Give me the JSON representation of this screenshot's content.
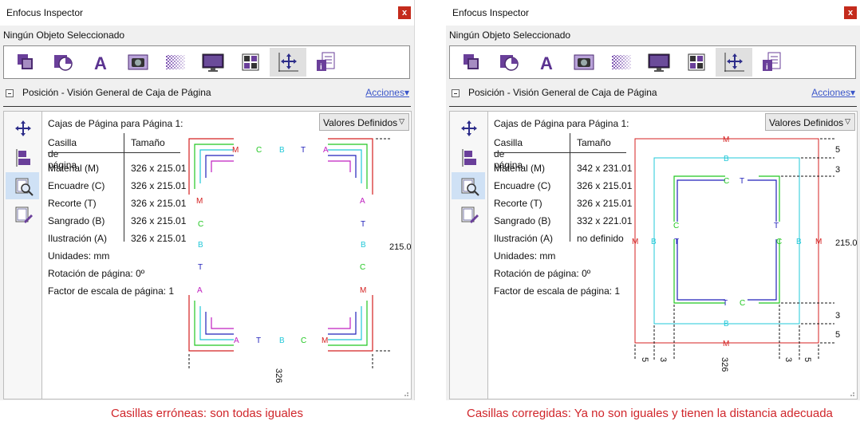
{
  "panels": [
    {
      "title": "Enfocus Inspector",
      "close": "x",
      "selection": "Ningún Objeto Seleccionado",
      "section_title": "Posición - Visión General de Caja de Página",
      "actions": "Acciones",
      "cajas_title": "Cajas de Página para Página 1:",
      "dropdown": "Valores Definidos",
      "col_box": "Casilla de página",
      "col_size": "Tamaño",
      "rows": [
        {
          "box": "Material (M)",
          "size": "326 x 215.01"
        },
        {
          "box": "Encuadre (C)",
          "size": "326 x 215.01"
        },
        {
          "box": "Recorte (T)",
          "size": "326 x 215.01"
        },
        {
          "box": "Sangrado (B)",
          "size": "326 x 215.01"
        },
        {
          "box": "Ilustración (A)",
          "size": "326 x 215.01"
        }
      ],
      "units": "Unidades: mm",
      "rotation": "Rotación de página: 0º",
      "scale": "Factor de escala de página: 1",
      "dim_w": "326",
      "dim_h": "215.0",
      "caption": "Casillas erróneas: son todas iguales"
    },
    {
      "title": "Enfocus Inspector",
      "close": "x",
      "selection": "Ningún Objeto Seleccionado",
      "section_title": "Posición - Visión General de Caja de Página",
      "actions": "Acciones",
      "cajas_title": "Cajas de Página para Página 1:",
      "dropdown": "Valores Definidos",
      "col_box": "Casilla de página",
      "col_size": "Tamaño",
      "rows": [
        {
          "box": "Material (M)",
          "size": "342 x 231.01"
        },
        {
          "box": "Encuadre (C)",
          "size": "326 x 215.01"
        },
        {
          "box": "Recorte (T)",
          "size": "326 x 215.01"
        },
        {
          "box": "Sangrado (B)",
          "size": "332 x 221.01"
        },
        {
          "box": "Ilustración (A)",
          "size": "no definido"
        }
      ],
      "units": "Unidades: mm",
      "rotation": "Rotación de página: 0º",
      "scale": "Factor de escala de página: 1",
      "dim_w": "326",
      "dim_h": "215.0",
      "margin_m": "5",
      "margin_b": "3",
      "caption": "Casillas corregidas: Ya no son iguales y tienen la distancia adecuada"
    }
  ],
  "box_letters": {
    "m": "M",
    "c": "C",
    "t": "T",
    "b": "B",
    "a": "A"
  },
  "colors": {
    "M": "#d42020",
    "C": "#22c722",
    "T": "#2222bb",
    "B": "#22c8d8",
    "A": "#c020c0",
    "caption": "#d0262b",
    "close": "#c42b1c",
    "link": "#3b56c9"
  },
  "toolbar_icons": [
    "object-icon",
    "shape-icon",
    "text-icon",
    "image-icon",
    "transparency-icon",
    "display-icon",
    "color-grid-icon",
    "position-icon",
    "info-document-icon"
  ],
  "sidebar_icons": [
    "move-icon",
    "align-icon",
    "page-box-zoom-icon",
    "page-box-edit-icon"
  ]
}
